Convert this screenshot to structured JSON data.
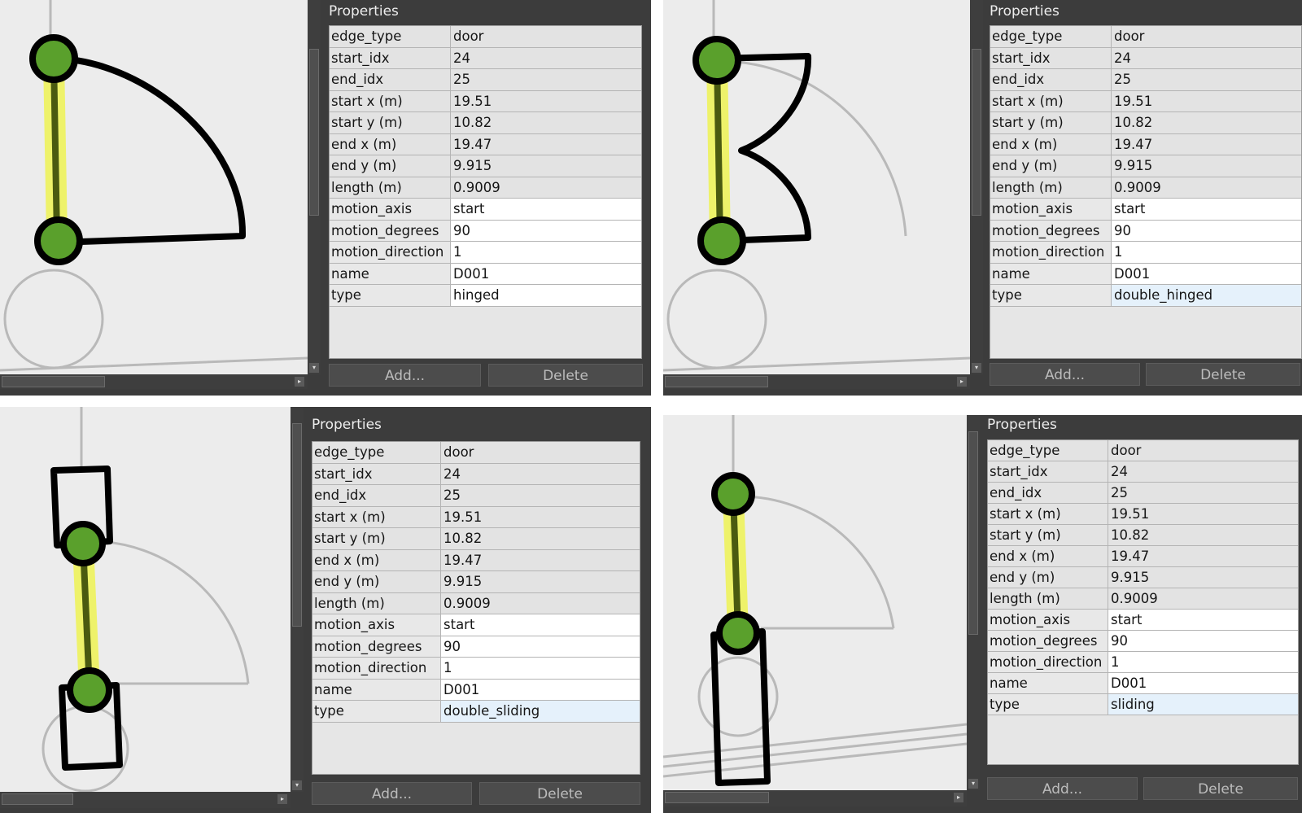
{
  "panels": [
    {
      "title": "Properties",
      "rows": [
        {
          "key": "edge_type",
          "value": "door"
        },
        {
          "key": "start_idx",
          "value": "24"
        },
        {
          "key": "end_idx",
          "value": "25"
        },
        {
          "key": "start x (m)",
          "value": "19.51"
        },
        {
          "key": "start y (m)",
          "value": "10.82"
        },
        {
          "key": "end x (m)",
          "value": "19.47"
        },
        {
          "key": "end y (m)",
          "value": "9.915"
        },
        {
          "key": "length (m)",
          "value": "0.9009"
        },
        {
          "key": "motion_axis",
          "value": "start"
        },
        {
          "key": "motion_degrees",
          "value": "90"
        },
        {
          "key": "motion_direction",
          "value": "1"
        },
        {
          "key": "name",
          "value": "D001"
        },
        {
          "key": "type",
          "value": "hinged"
        }
      ],
      "add_label": "Add...",
      "delete_label": "Delete"
    },
    {
      "title": "Properties",
      "rows": [
        {
          "key": "edge_type",
          "value": "door"
        },
        {
          "key": "start_idx",
          "value": "24"
        },
        {
          "key": "end_idx",
          "value": "25"
        },
        {
          "key": "start x (m)",
          "value": "19.51"
        },
        {
          "key": "start y (m)",
          "value": "10.82"
        },
        {
          "key": "end x (m)",
          "value": "19.47"
        },
        {
          "key": "end y (m)",
          "value": "9.915"
        },
        {
          "key": "length (m)",
          "value": "0.9009"
        },
        {
          "key": "motion_axis",
          "value": "start"
        },
        {
          "key": "motion_degrees",
          "value": "90"
        },
        {
          "key": "motion_direction",
          "value": "1"
        },
        {
          "key": "name",
          "value": "D001"
        },
        {
          "key": "type",
          "value": "double_hinged"
        }
      ],
      "add_label": "Add...",
      "delete_label": "Delete"
    },
    {
      "title": "Properties",
      "rows": [
        {
          "key": "edge_type",
          "value": "door"
        },
        {
          "key": "start_idx",
          "value": "24"
        },
        {
          "key": "end_idx",
          "value": "25"
        },
        {
          "key": "start x (m)",
          "value": "19.51"
        },
        {
          "key": "start y (m)",
          "value": "10.82"
        },
        {
          "key": "end x (m)",
          "value": "19.47"
        },
        {
          "key": "end y (m)",
          "value": "9.915"
        },
        {
          "key": "length (m)",
          "value": "0.9009"
        },
        {
          "key": "motion_axis",
          "value": "start"
        },
        {
          "key": "motion_degrees",
          "value": "90"
        },
        {
          "key": "motion_direction",
          "value": "1"
        },
        {
          "key": "name",
          "value": "D001"
        },
        {
          "key": "type",
          "value": "double_sliding"
        }
      ],
      "add_label": "Add...",
      "delete_label": "Delete"
    },
    {
      "title": "Properties",
      "rows": [
        {
          "key": "edge_type",
          "value": "door"
        },
        {
          "key": "start_idx",
          "value": "24"
        },
        {
          "key": "end_idx",
          "value": "25"
        },
        {
          "key": "start x (m)",
          "value": "19.51"
        },
        {
          "key": "start y (m)",
          "value": "10.82"
        },
        {
          "key": "end x (m)",
          "value": "19.47"
        },
        {
          "key": "end y (m)",
          "value": "9.915"
        },
        {
          "key": "length (m)",
          "value": "0.9009"
        },
        {
          "key": "motion_axis",
          "value": "start"
        },
        {
          "key": "motion_degrees",
          "value": "90"
        },
        {
          "key": "motion_direction",
          "value": "1"
        },
        {
          "key": "name",
          "value": "D001"
        },
        {
          "key": "type",
          "value": "sliding"
        }
      ],
      "add_label": "Add...",
      "delete_label": "Delete"
    }
  ],
  "colors": {
    "canvas": "#ececec",
    "wall": "#b9b9b9",
    "door_stroke": "#000000",
    "vertex_fill": "#5aa02c",
    "edge_highlight": "#eef26a",
    "edge_line": "#4a5a10"
  }
}
